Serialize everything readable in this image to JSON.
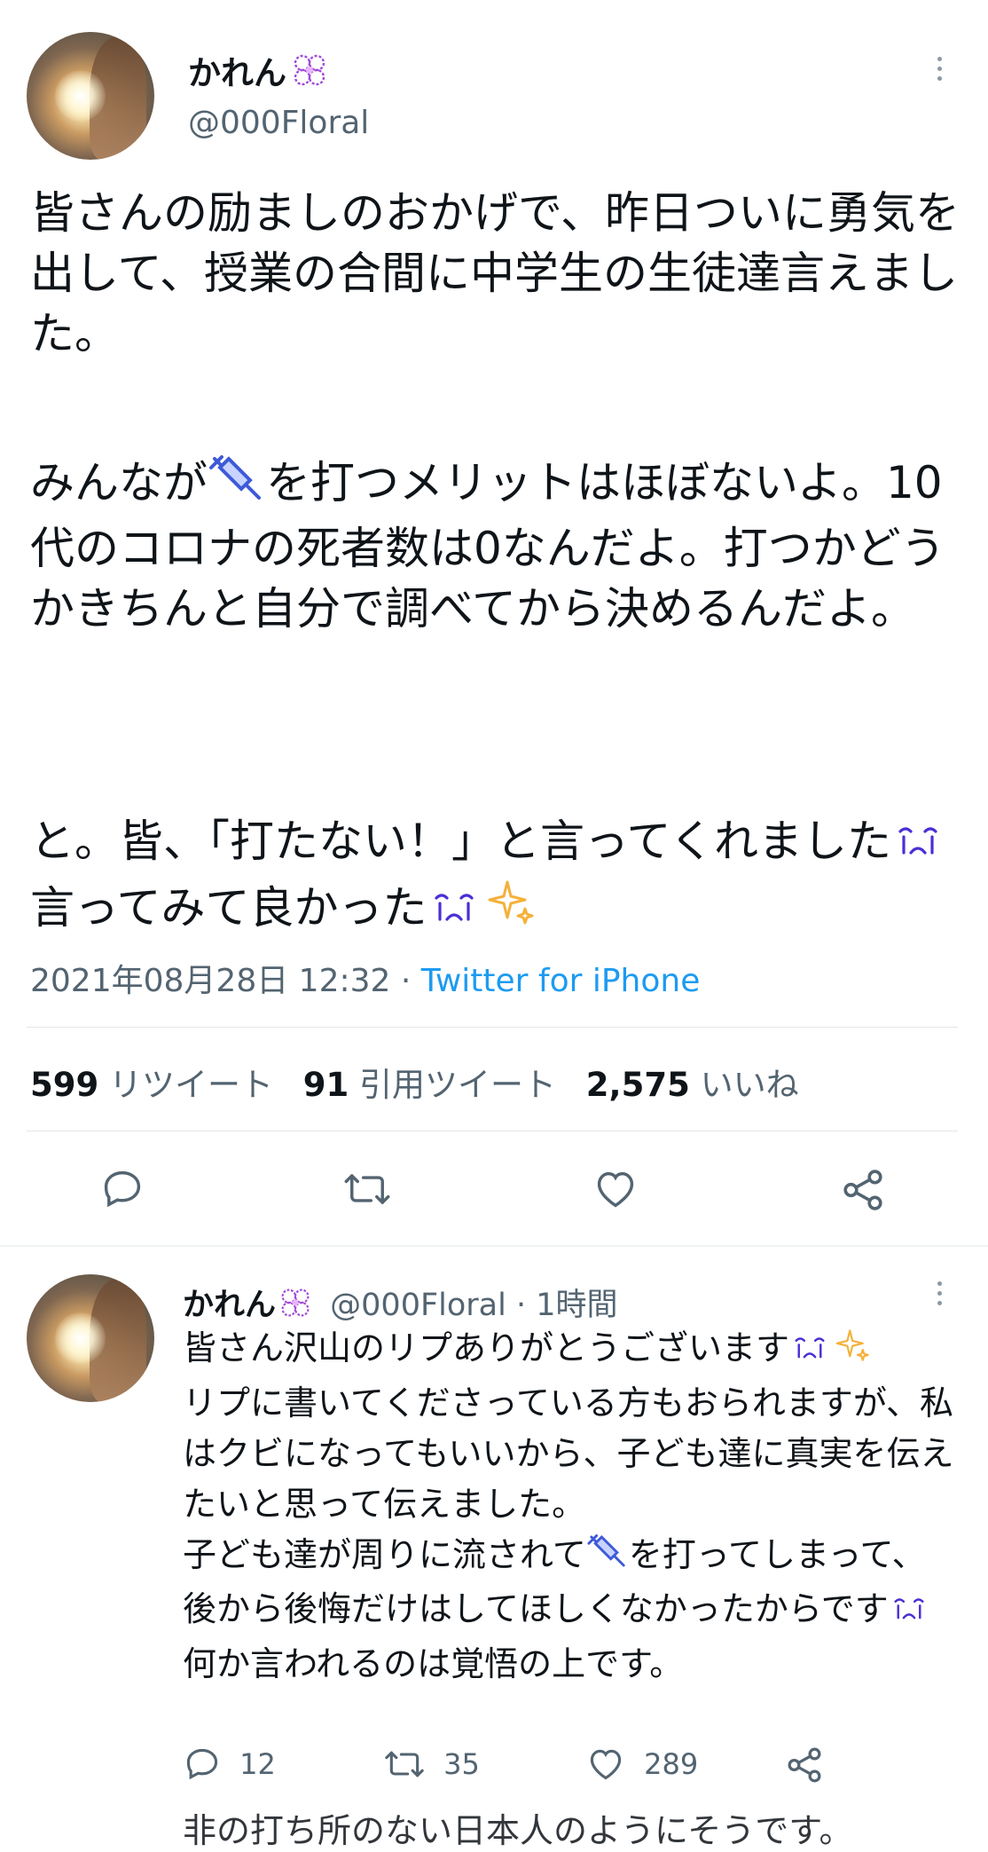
{
  "main_tweet": {
    "display_name": "かれん",
    "name_emoji": "flower-icon",
    "handle": "@000Floral",
    "text_part1": "皆さんの励ましのおかげで、昨日ついに勇気を出して、授業の合間に中学生の生徒達言えました。",
    "text_part2a": "みんなが",
    "text_part2b": "を打つメリットはほぼないよ。10代のコロナの死者数は0なんだよ。打つかどうかきちんと自分で調べてから決めるんだよ。",
    "text_part3a": "と。皆、「打たない！」と言ってくれました",
    "text_part3b": "言ってみて良かった",
    "date": "2021年08月28日 12:32",
    "separator": "·",
    "source": "Twitter for iPhone",
    "retweets_count": "599",
    "retweets_label": "リツイート",
    "quotes_count": "91",
    "quotes_label": "引用ツイート",
    "likes_count": "2,575",
    "likes_label": "いいね"
  },
  "reply_tweet": {
    "display_name": "かれん",
    "handle": "@000Floral",
    "separator": "·",
    "time": "1時間",
    "line1": "皆さん沢山のリプありがとうございます",
    "line2": "リプに書いてくださっている方もおられますが、私はクビになってもいいから、子ども達に真実を伝えたいと思って伝えました。",
    "line3a": "子ども達が周りに流されて",
    "line3b": "を打ってしまって、後から後悔だけはしてほしくなかったからです",
    "line4": "何か言われるのは覚悟の上です。",
    "replies_count": "12",
    "retweets_count": "35",
    "likes_count": "289",
    "cut_text": "非の打ち所のない日本人のようにそうです。"
  },
  "colors": {
    "text": "#0f1419",
    "muted": "#536471",
    "link": "#1d9bf0",
    "emoji_purple": "#7b61ff",
    "emoji_gold": "#f4b13a"
  }
}
